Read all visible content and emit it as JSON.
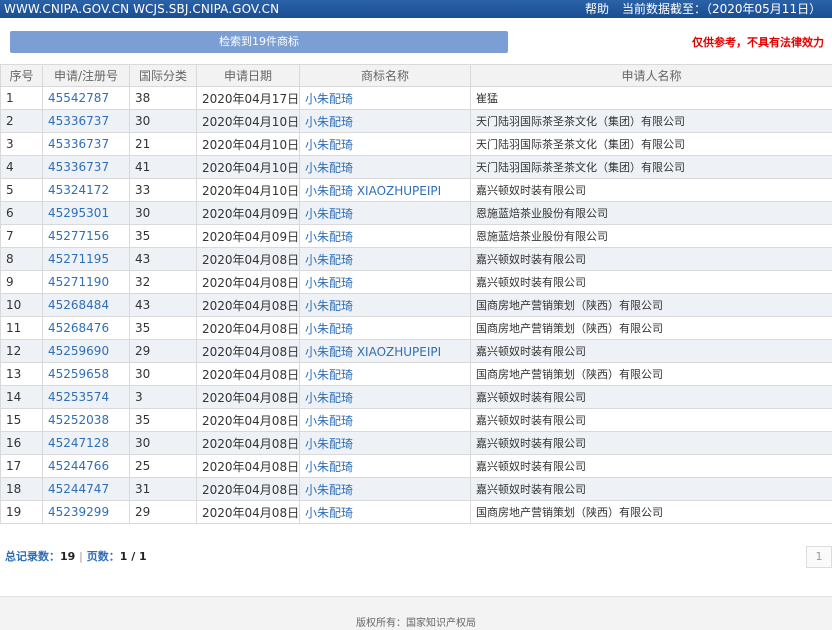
{
  "topbar": {
    "site": "WWW.CNIPA.GOV.CN WCJS.SBJ.CNIPA.GOV.CN",
    "help": "帮助",
    "data_date": "当前数据截至：（2020年05月11日）"
  },
  "search_button": "检索到19件商标",
  "disclaimer": "仅供参考，不具有法律效力",
  "columns": [
    "序号",
    "申请/注册号",
    "国际分类",
    "申请日期",
    "商标名称",
    "申请人名称"
  ],
  "rows": [
    {
      "no": "1",
      "reg": "45542787",
      "cls": "38",
      "date": "2020年04月17日",
      "name": "小朱配琦",
      "applicant": "崔猛"
    },
    {
      "no": "2",
      "reg": "45336737",
      "cls": "30",
      "date": "2020年04月10日",
      "name": "小朱配琦",
      "applicant": "天门陆羽国际茶圣茶文化（集团）有限公司"
    },
    {
      "no": "3",
      "reg": "45336737",
      "cls": "21",
      "date": "2020年04月10日",
      "name": "小朱配琦",
      "applicant": "天门陆羽国际茶圣茶文化（集团）有限公司"
    },
    {
      "no": "4",
      "reg": "45336737",
      "cls": "41",
      "date": "2020年04月10日",
      "name": "小朱配琦",
      "applicant": "天门陆羽国际茶圣茶文化（集团）有限公司"
    },
    {
      "no": "5",
      "reg": "45324172",
      "cls": "33",
      "date": "2020年04月10日",
      "name": "小朱配琦 XIAOZHUPEIPI",
      "applicant": "嘉兴顿奴时装有限公司"
    },
    {
      "no": "6",
      "reg": "45295301",
      "cls": "30",
      "date": "2020年04月09日",
      "name": "小朱配琦",
      "applicant": "恩施蓝焙茶业股份有限公司"
    },
    {
      "no": "7",
      "reg": "45277156",
      "cls": "35",
      "date": "2020年04月09日",
      "name": "小朱配琦",
      "applicant": "恩施蓝焙茶业股份有限公司"
    },
    {
      "no": "8",
      "reg": "45271195",
      "cls": "43",
      "date": "2020年04月08日",
      "name": "小朱配琦",
      "applicant": "嘉兴顿奴时装有限公司"
    },
    {
      "no": "9",
      "reg": "45271190",
      "cls": "32",
      "date": "2020年04月08日",
      "name": "小朱配琦",
      "applicant": "嘉兴顿奴时装有限公司"
    },
    {
      "no": "10",
      "reg": "45268484",
      "cls": "43",
      "date": "2020年04月08日",
      "name": "小朱配琦",
      "applicant": "国商房地产营销策划（陕西）有限公司"
    },
    {
      "no": "11",
      "reg": "45268476",
      "cls": "35",
      "date": "2020年04月08日",
      "name": "小朱配琦",
      "applicant": "国商房地产营销策划（陕西）有限公司"
    },
    {
      "no": "12",
      "reg": "45259690",
      "cls": "29",
      "date": "2020年04月08日",
      "name": "小朱配琦 XIAOZHUPEIPI",
      "applicant": "嘉兴顿奴时装有限公司"
    },
    {
      "no": "13",
      "reg": "45259658",
      "cls": "30",
      "date": "2020年04月08日",
      "name": "小朱配琦",
      "applicant": "国商房地产营销策划（陕西）有限公司"
    },
    {
      "no": "14",
      "reg": "45253574",
      "cls": "3",
      "date": "2020年04月08日",
      "name": "小朱配琦",
      "applicant": "嘉兴顿奴时装有限公司"
    },
    {
      "no": "15",
      "reg": "45252038",
      "cls": "35",
      "date": "2020年04月08日",
      "name": "小朱配琦",
      "applicant": "嘉兴顿奴时装有限公司"
    },
    {
      "no": "16",
      "reg": "45247128",
      "cls": "30",
      "date": "2020年04月08日",
      "name": "小朱配琦",
      "applicant": "嘉兴顿奴时装有限公司"
    },
    {
      "no": "17",
      "reg": "45244766",
      "cls": "25",
      "date": "2020年04月08日",
      "name": "小朱配琦",
      "applicant": "嘉兴顿奴时装有限公司"
    },
    {
      "no": "18",
      "reg": "45244747",
      "cls": "31",
      "date": "2020年04月08日",
      "name": "小朱配琦",
      "applicant": "嘉兴顿奴时装有限公司"
    },
    {
      "no": "19",
      "reg": "45239299",
      "cls": "29",
      "date": "2020年04月08日",
      "name": "小朱配琦",
      "applicant": "国商房地产营销策划（陕西）有限公司"
    }
  ],
  "summary": {
    "total_label": "总记录数：",
    "total_value": "19",
    "separator": "|",
    "pages_label": "页数：",
    "pages_value": "1 / 1"
  },
  "pagination": {
    "current": "1"
  },
  "footer": {
    "copyright": "版权所有：国家知识产权局"
  },
  "colors": {
    "topbar": "#1b4d92",
    "button": "#7b9fd4",
    "link": "#2f6fb7",
    "disclaimer": "#e00000"
  }
}
